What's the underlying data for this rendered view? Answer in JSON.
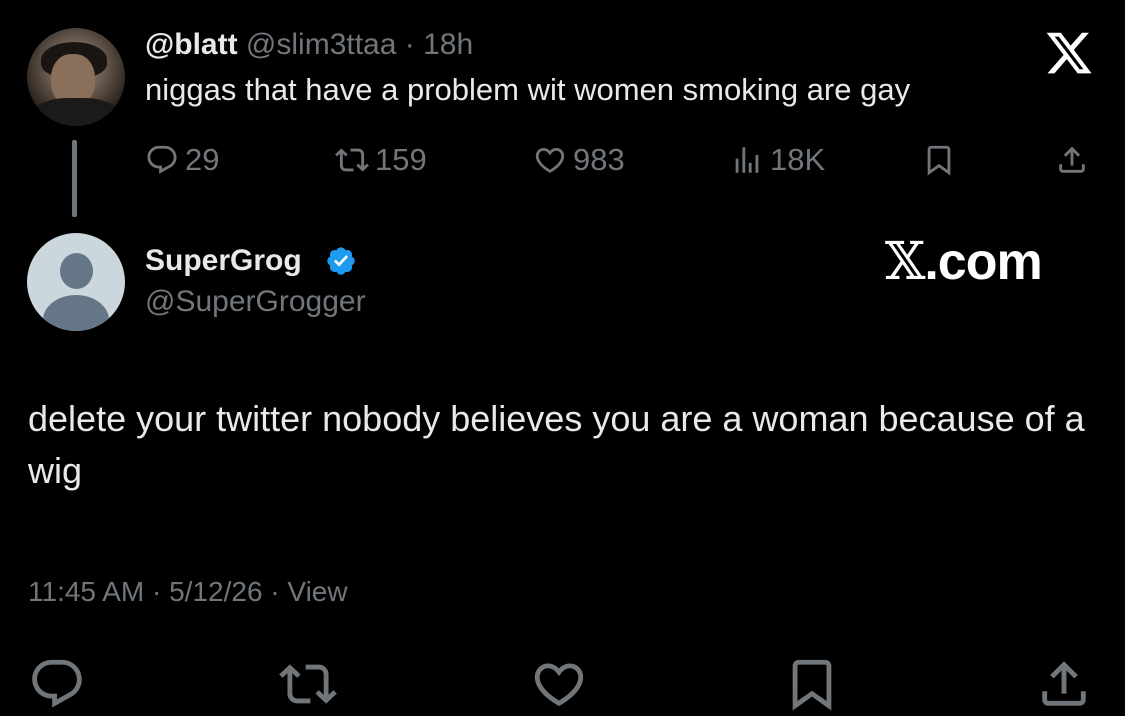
{
  "parent_tweet": {
    "display_name": "@blatt",
    "handle": "@slim3ttaa",
    "separator": "·",
    "time": "18h",
    "text": "niggas that have a problem wit women smoking are gay",
    "actions": {
      "replies": "29",
      "reposts": "159",
      "likes": "983",
      "views": "18K"
    }
  },
  "reply_tweet": {
    "display_name": "SuperGrog",
    "handle": "@SuperGrogger",
    "verified": true,
    "text": "delete your twitter nobody believes you are a woman because of a wig",
    "timestamp": "11:45 AM · 5/12/26 · View"
  },
  "watermark": {
    "x_glyph": "𝕏",
    "domain": ".com"
  },
  "icons": [
    "reply-icon",
    "repost-icon",
    "like-icon",
    "views-icon",
    "bookmark-icon",
    "share-icon",
    "x-logo-icon",
    "verified-badge-icon"
  ],
  "colors": {
    "background": "#000000",
    "primary_text": "#e7e9ea",
    "secondary_text": "#71767b",
    "verified_blue": "#1d9bf0"
  }
}
